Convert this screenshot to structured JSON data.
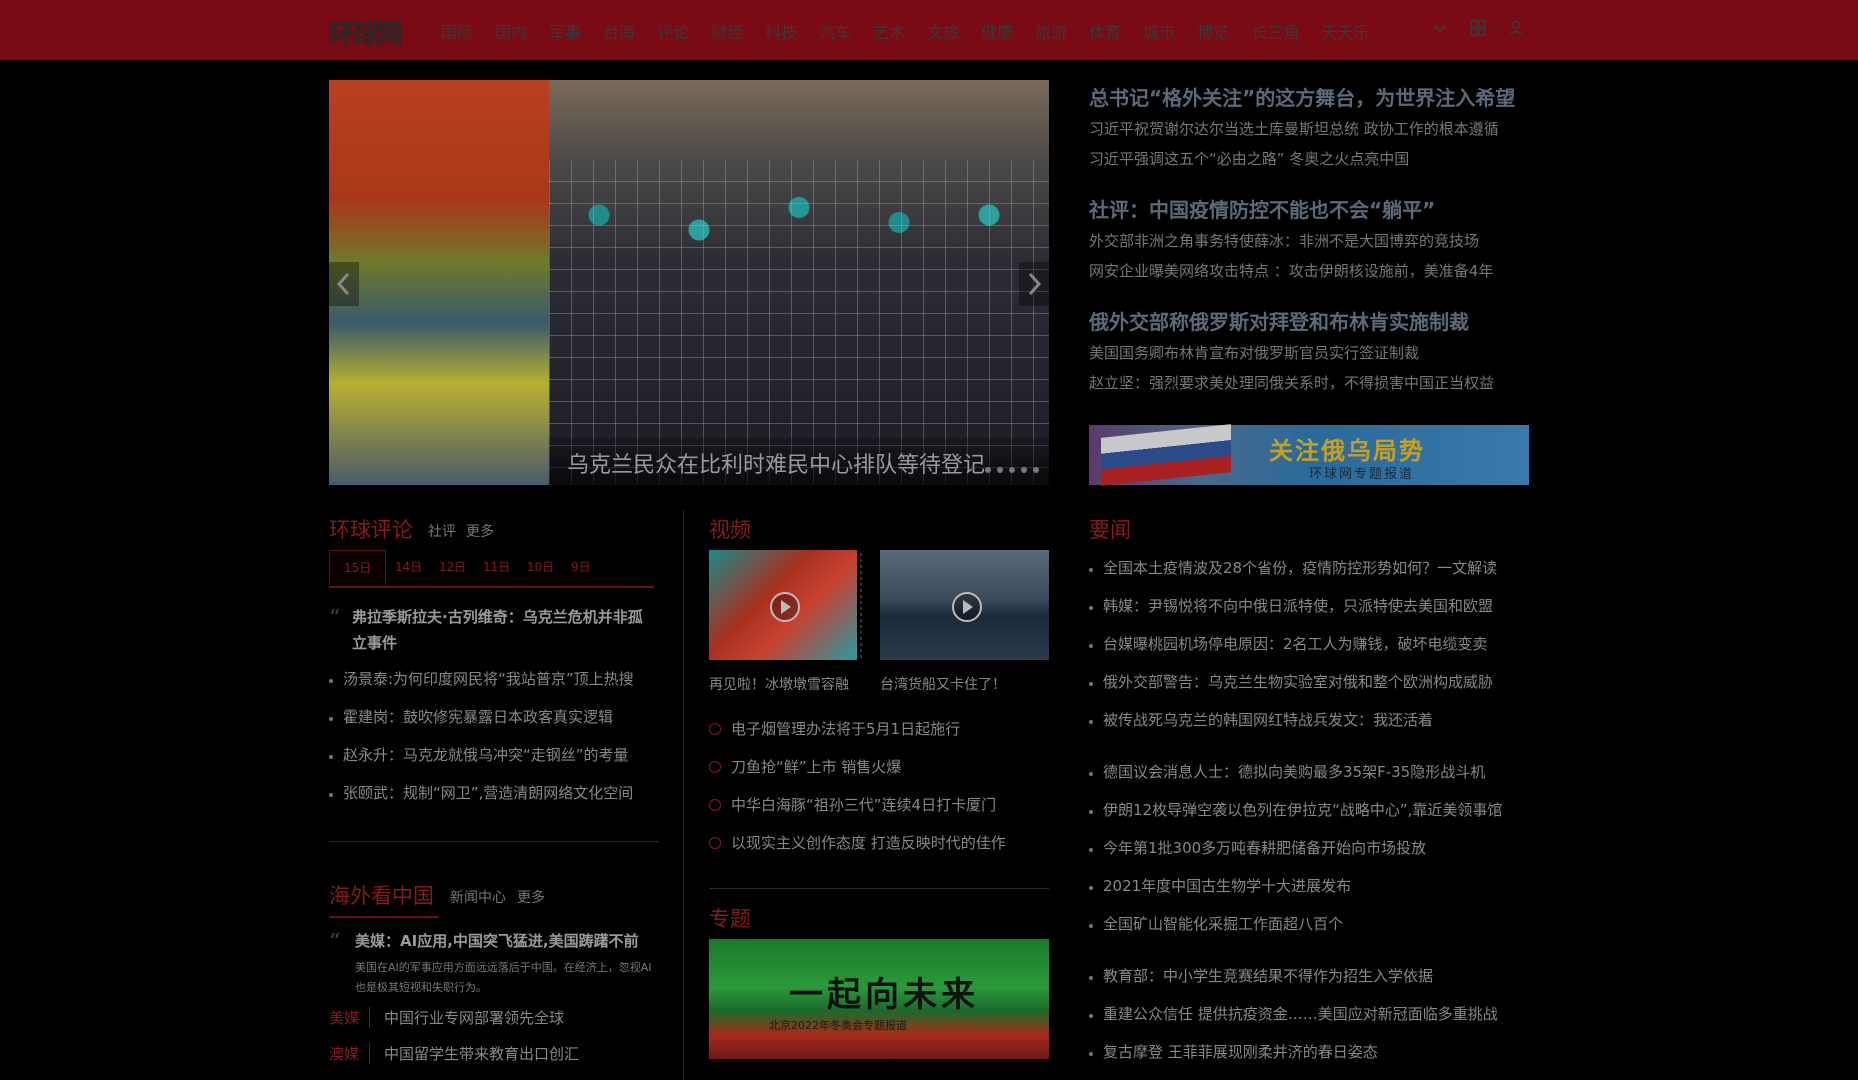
{
  "header": {
    "logo": "环球网",
    "nav": [
      "国际",
      "国内",
      "军事",
      "台海",
      "评论",
      "财经",
      "科技",
      "汽车",
      "艺术",
      "文旅",
      "健康",
      "旅游",
      "体育",
      "城市",
      "博览",
      "长三角",
      "天天乐"
    ]
  },
  "carousel": {
    "caption": "乌克兰民众在比利时难民中心排队等待登记",
    "dots": 5
  },
  "headlines": [
    {
      "title": "总书记“格外关注”的这方舞台，为世界注入希望",
      "subs": [
        "习近平祝贺谢尔达尔当选土库曼斯坦总统 政协工作的根本遵循",
        "习近平强调这五个“必由之路” 冬奥之火点亮中国"
      ]
    },
    {
      "title": "社评：中国疫情防控不能也不会“躺平”",
      "subs": [
        "外交部非洲之角事务特使薛冰：非洲不是大国博弈的竞技场",
        "网安企业曝美网络攻击特点 ：攻击伊朗核设施前，美准备4年"
      ]
    },
    {
      "title": "俄外交部称俄罗斯对拜登和布林肯实施制裁",
      "subs": [
        "美国国务卿布林肯宣布对俄罗斯官员实行签证制裁",
        "赵立坚：强烈要求美处理同俄关系时，不得损害中国正当权益"
      ]
    }
  ],
  "banner": {
    "title": "关注俄乌局势",
    "sub": "环球网专题报道"
  },
  "comment": {
    "title": "环球评论",
    "links": [
      "社评",
      "更多"
    ],
    "tabs": [
      "15日",
      "14日",
      "12日",
      "11日",
      "10日",
      "9日"
    ],
    "quote": "弗拉季斯拉夫·古列维奇：乌克兰危机并非孤立事件",
    "items": [
      "汤景泰:为何印度网民将“我站普京”顶上热搜",
      "霍建岗：鼓吹修宪暴露日本政客真实逻辑",
      "赵永升：马克龙就俄乌冲突“走钢丝”的考量",
      "张颐武：规制“网卫”,营造清朗网络文化空间"
    ]
  },
  "overseas": {
    "title": "海外看中国",
    "links": [
      "新闻中心",
      "更多"
    ],
    "quote_title": "美媒：AI应用,中国突飞猛进,美国踌躇不前",
    "quote_text": "美国在AI的军事应用方面远远落后于中国。在经济上，忽视AI也是极其短视和失职行为。",
    "rows": [
      {
        "src": "美媒",
        "text": "中国行业专网部署领先全球"
      },
      {
        "src": "澳媒",
        "text": "中国留学生带来教育出口创汇"
      }
    ]
  },
  "video": {
    "title": "视频",
    "thumbs": [
      {
        "caption": "再见啦！冰墩墩雪容融"
      },
      {
        "caption": "台湾货船又卡住了！"
      }
    ],
    "items": [
      "电子烟管理办法将于5月1日起施行",
      "刀鱼抢“鲜”上市 销售火爆",
      "中华白海豚“祖孙三代”连续4日打卡厦门",
      "以现实主义创作态度 打造反映时代的佳作"
    ]
  },
  "special": {
    "title": "专题",
    "banner_title": "一起向未来",
    "banner_sub": "北京2022年冬奥会专题报道"
  },
  "news": {
    "title": "要闻",
    "group1": [
      "全国本土疫情波及28个省份，疫情防控形势如何？一文解读",
      "韩媒：尹锡悦将不向中俄日派特使，只派特使去美国和欧盟",
      "台媒曝桃园机场停电原因：2名工人为赚钱，破坏电缆变卖",
      "俄外交部警告：乌克兰生物实验室对俄和整个欧洲构成威胁",
      "被传战死乌克兰的韩国网红特战兵发文：我还活着"
    ],
    "group2": [
      "德国议会消息人士：德拟向美购最多35架F-35隐形战斗机",
      "伊朗12枚导弹空袭以色列在伊拉克“战略中心”,靠近美领事馆",
      "今年第1批300多万吨春耕肥储备开始向市场投放",
      "2021年度中国古生物学十大进展发布",
      "全国矿山智能化采掘工作面超八百个"
    ],
    "group3": [
      "教育部：中小学生竞赛结果不得作为招生入学依据",
      "重建公众信任 提供抗疫资金……美国应对新冠面临多重挑战",
      "复古摩登 王菲菲展现刚柔并济的春日姿态"
    ]
  }
}
